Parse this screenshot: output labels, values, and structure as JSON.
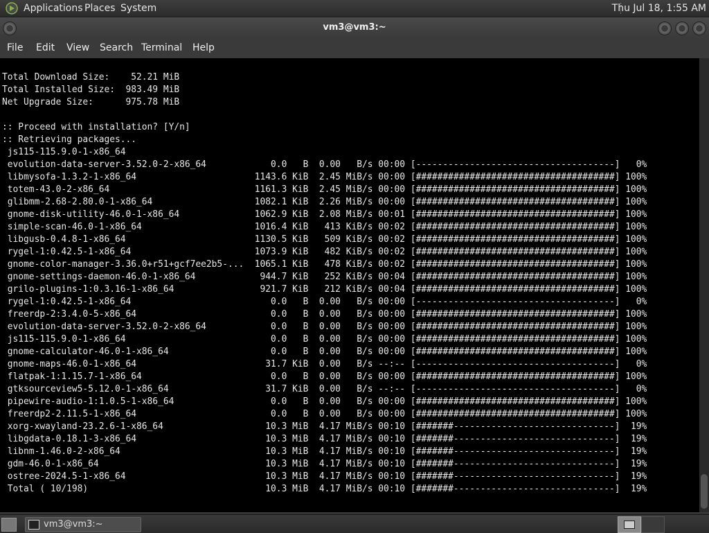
{
  "top_panel": {
    "menus": [
      "Applications",
      "Places",
      "System"
    ],
    "clock": "Thu Jul 18,  1:55 AM"
  },
  "window": {
    "title": "vm3@vm3:~"
  },
  "menubar": {
    "items": [
      "File",
      "Edit",
      "View",
      "Search",
      "Terminal",
      "Help"
    ]
  },
  "terminal": {
    "lines": [
      "Total Download Size:    52.21 MiB",
      "Total Installed Size:  983.49 MiB",
      "Net Upgrade Size:      975.78 MiB",
      "",
      ":: Proceed with installation? [Y/n]",
      ":: Retrieving packages...",
      " js115-115.9.0-1-x86_64",
      " evolution-data-server-3.52.0-2-x86_64            0.0   B  0.00   B/s 00:00 [-------------------------------------]   0%",
      " libmysofa-1.3.2-1-x86_64                      1143.6 KiB  2.45 MiB/s 00:00 [#####################################] 100%",
      " totem-43.0-2-x86_64                           1161.3 KiB  2.45 MiB/s 00:00 [#####################################] 100%",
      " glibmm-2.68-2.80.0-1-x86_64                   1082.1 KiB  2.26 MiB/s 00:00 [#####################################] 100%",
      " gnome-disk-utility-46.0-1-x86_64              1062.9 KiB  2.08 MiB/s 00:01 [#####################################] 100%",
      " simple-scan-46.0-1-x86_64                     1016.4 KiB   413 KiB/s 00:02 [#####################################] 100%",
      " libgusb-0.4.8-1-x86_64                        1130.5 KiB   509 KiB/s 00:02 [#####################################] 100%",
      " rygel-1:0.42.5-1-x86_64                       1073.9 KiB   482 KiB/s 00:02 [#####################################] 100%",
      " gnome-color-manager-3.36.0+r51+gcf7ee2b5-...  1065.1 KiB   478 KiB/s 00:02 [#####################################] 100%",
      " gnome-settings-daemon-46.0-1-x86_64            944.7 KiB   252 KiB/s 00:04 [#####################################] 100%",
      " grilo-plugins-1:0.3.16-1-x86_64                921.7 KiB   212 KiB/s 00:04 [#####################################] 100%",
      " rygel-1:0.42.5-1-x86_64                          0.0   B  0.00   B/s 00:00 [-------------------------------------]   0%",
      " freerdp-2:3.4.0-5-x86_64                         0.0   B  0.00   B/s 00:00 [#####################################] 100%",
      " evolution-data-server-3.52.0-2-x86_64            0.0   B  0.00   B/s 00:00 [#####################################] 100%",
      " js115-115.9.0-1-x86_64                           0.0   B  0.00   B/s 00:00 [#####################################] 100%",
      " gnome-calculator-46.0-1-x86_64                   0.0   B  0.00   B/s 00:00 [#####################################] 100%",
      " gnome-maps-46.0-1-x86_64                        31.7 KiB  0.00   B/s --:-- [-------------------------------------]   0%",
      " flatpak-1:1.15.7-1-x86_64                        0.0   B  0.00   B/s 00:00 [#####################################] 100%",
      " gtksourceview5-5.12.0-1-x86_64                  31.7 KiB  0.00   B/s --:-- [-------------------------------------]   0%",
      " pipewire-audio-1:1.0.5-1-x86_64                  0.0   B  0.00   B/s 00:00 [#####################################] 100%",
      " freerdp2-2.11.5-1-x86_64                         0.0   B  0.00   B/s 00:00 [#####################################] 100%",
      " xorg-xwayland-23.2.6-1-x86_64                   10.3 MiB  4.17 MiB/s 00:10 [#######------------------------------]  19%",
      " libgdata-0.18.1-3-x86_64                        10.3 MiB  4.17 MiB/s 00:10 [#######------------------------------]  19%",
      " libnm-1.46.0-2-x86_64                           10.3 MiB  4.17 MiB/s 00:10 [#######------------------------------]  19%",
      " gdm-46.0-1-x86_64                               10.3 MiB  4.17 MiB/s 00:10 [#######------------------------------]  19%",
      " ostree-2024.5-1-x86_64                          10.3 MiB  4.17 MiB/s 00:10 [#######------------------------------]  19%",
      " Total ( 10/198)                                 10.3 MiB  4.17 MiB/s 00:10 [#######------------------------------]  19%"
    ]
  },
  "taskbar": {
    "task_label": "vm3@vm3:~"
  }
}
